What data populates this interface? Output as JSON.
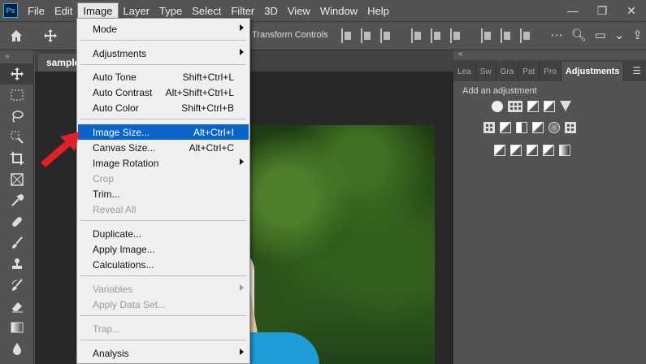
{
  "app": {
    "logo": "Ps"
  },
  "menubar": {
    "items": [
      "File",
      "Edit",
      "Image",
      "Layer",
      "Type",
      "Select",
      "Filter",
      "3D",
      "View",
      "Window",
      "Help"
    ],
    "active_index": 2
  },
  "window_controls": {
    "minimize": "—",
    "restore": "❐",
    "close": "✕"
  },
  "options_bar": {
    "transform_controls_label": "Transform Controls"
  },
  "document": {
    "tab_title": "sample."
  },
  "panels": {
    "tabs": [
      "Lea",
      "Sw",
      "Gra",
      "Pat",
      "Pro",
      "Adjustments"
    ],
    "active_tab_index": 5,
    "add_adjustment_label": "Add an adjustment",
    "adjustment_icons": [
      [
        "brightness-contrast-icon",
        "levels-icon",
        "curves-icon",
        "exposure-icon",
        "vibrance-icon"
      ],
      [
        "hue-saturation-icon",
        "color-balance-icon",
        "black-white-icon",
        "photo-filter-icon",
        "channel-mixer-icon",
        "color-lookup-icon"
      ],
      [
        "invert-icon",
        "posterize-icon",
        "threshold-icon",
        "selective-color-icon",
        "gradient-map-icon"
      ]
    ]
  },
  "image_menu": {
    "items": [
      {
        "label": "Mode",
        "shortcut": "",
        "submenu": true,
        "disabled": false
      },
      {
        "label": "Adjustments",
        "shortcut": "",
        "submenu": true,
        "disabled": false
      },
      {
        "label": "Auto Tone",
        "shortcut": "Shift+Ctrl+L",
        "submenu": false,
        "disabled": false
      },
      {
        "label": "Auto Contrast",
        "shortcut": "Alt+Shift+Ctrl+L",
        "submenu": false,
        "disabled": false
      },
      {
        "label": "Auto Color",
        "shortcut": "Shift+Ctrl+B",
        "submenu": false,
        "disabled": false
      },
      {
        "label": "Image Size...",
        "shortcut": "Alt+Ctrl+I",
        "submenu": false,
        "disabled": false,
        "highlighted": true
      },
      {
        "label": "Canvas Size...",
        "shortcut": "Alt+Ctrl+C",
        "submenu": false,
        "disabled": false
      },
      {
        "label": "Image Rotation",
        "shortcut": "",
        "submenu": true,
        "disabled": false
      },
      {
        "label": "Crop",
        "shortcut": "",
        "submenu": false,
        "disabled": true
      },
      {
        "label": "Trim...",
        "shortcut": "",
        "submenu": false,
        "disabled": false
      },
      {
        "label": "Reveal All",
        "shortcut": "",
        "submenu": false,
        "disabled": true
      },
      {
        "label": "Duplicate...",
        "shortcut": "",
        "submenu": false,
        "disabled": false
      },
      {
        "label": "Apply Image...",
        "shortcut": "",
        "submenu": false,
        "disabled": false
      },
      {
        "label": "Calculations...",
        "shortcut": "",
        "submenu": false,
        "disabled": false
      },
      {
        "label": "Variables",
        "shortcut": "",
        "submenu": true,
        "disabled": true
      },
      {
        "label": "Apply Data Set...",
        "shortcut": "",
        "submenu": false,
        "disabled": true
      },
      {
        "label": "Trap...",
        "shortcut": "",
        "submenu": false,
        "disabled": true
      },
      {
        "label": "Analysis",
        "shortcut": "",
        "submenu": true,
        "disabled": false
      }
    ]
  },
  "colors": {
    "ui_background": "#535353",
    "menu_highlight": "#0a64c8",
    "annotation_arrow": "#e0202a"
  }
}
